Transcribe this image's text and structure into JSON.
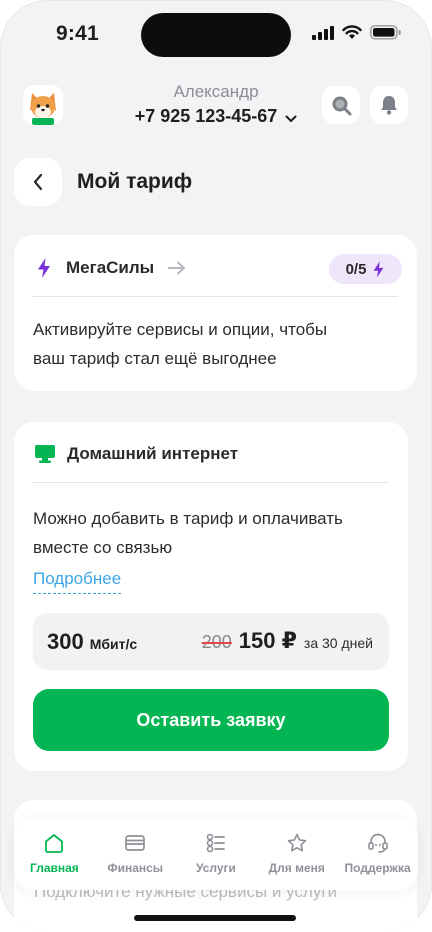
{
  "status_bar": {
    "time": "9:41"
  },
  "header": {
    "user_name": "Александр",
    "phone": "+7 925 123-45-67"
  },
  "page": {
    "title": "Мой тариф"
  },
  "megasily_card": {
    "title": "МегаСилы",
    "badge": "0/5",
    "description_line1": "Активируйте сервисы и опции, чтобы",
    "description_line2": "ваш тариф стал ещё выгоднее",
    "accent_color": "#7b2fd6"
  },
  "internet_card": {
    "title": "Домашний интернет",
    "description_line1": "Можно добавить в тариф и оплачивать",
    "description_line2": "вместе со связью",
    "more_link": "Подробнее",
    "speed_value": "300",
    "speed_unit": "Мбит/с",
    "old_price": "200",
    "new_price": "150 ₽",
    "period": "за 30 дней",
    "cta_label": "Оставить заявку",
    "cta_color": "#04b653"
  },
  "services_card": {
    "text": "Подключите нужные сервисы и услуги"
  },
  "tabbar": {
    "items": [
      {
        "label": "Главная",
        "icon": "home-icon",
        "active": true
      },
      {
        "label": "Финансы",
        "icon": "wallet-icon",
        "active": false
      },
      {
        "label": "Услуги",
        "icon": "services-icon",
        "active": false
      },
      {
        "label": "Для меня",
        "icon": "star-icon",
        "active": false
      },
      {
        "label": "Поддержка",
        "icon": "support-icon",
        "active": false
      }
    ]
  }
}
